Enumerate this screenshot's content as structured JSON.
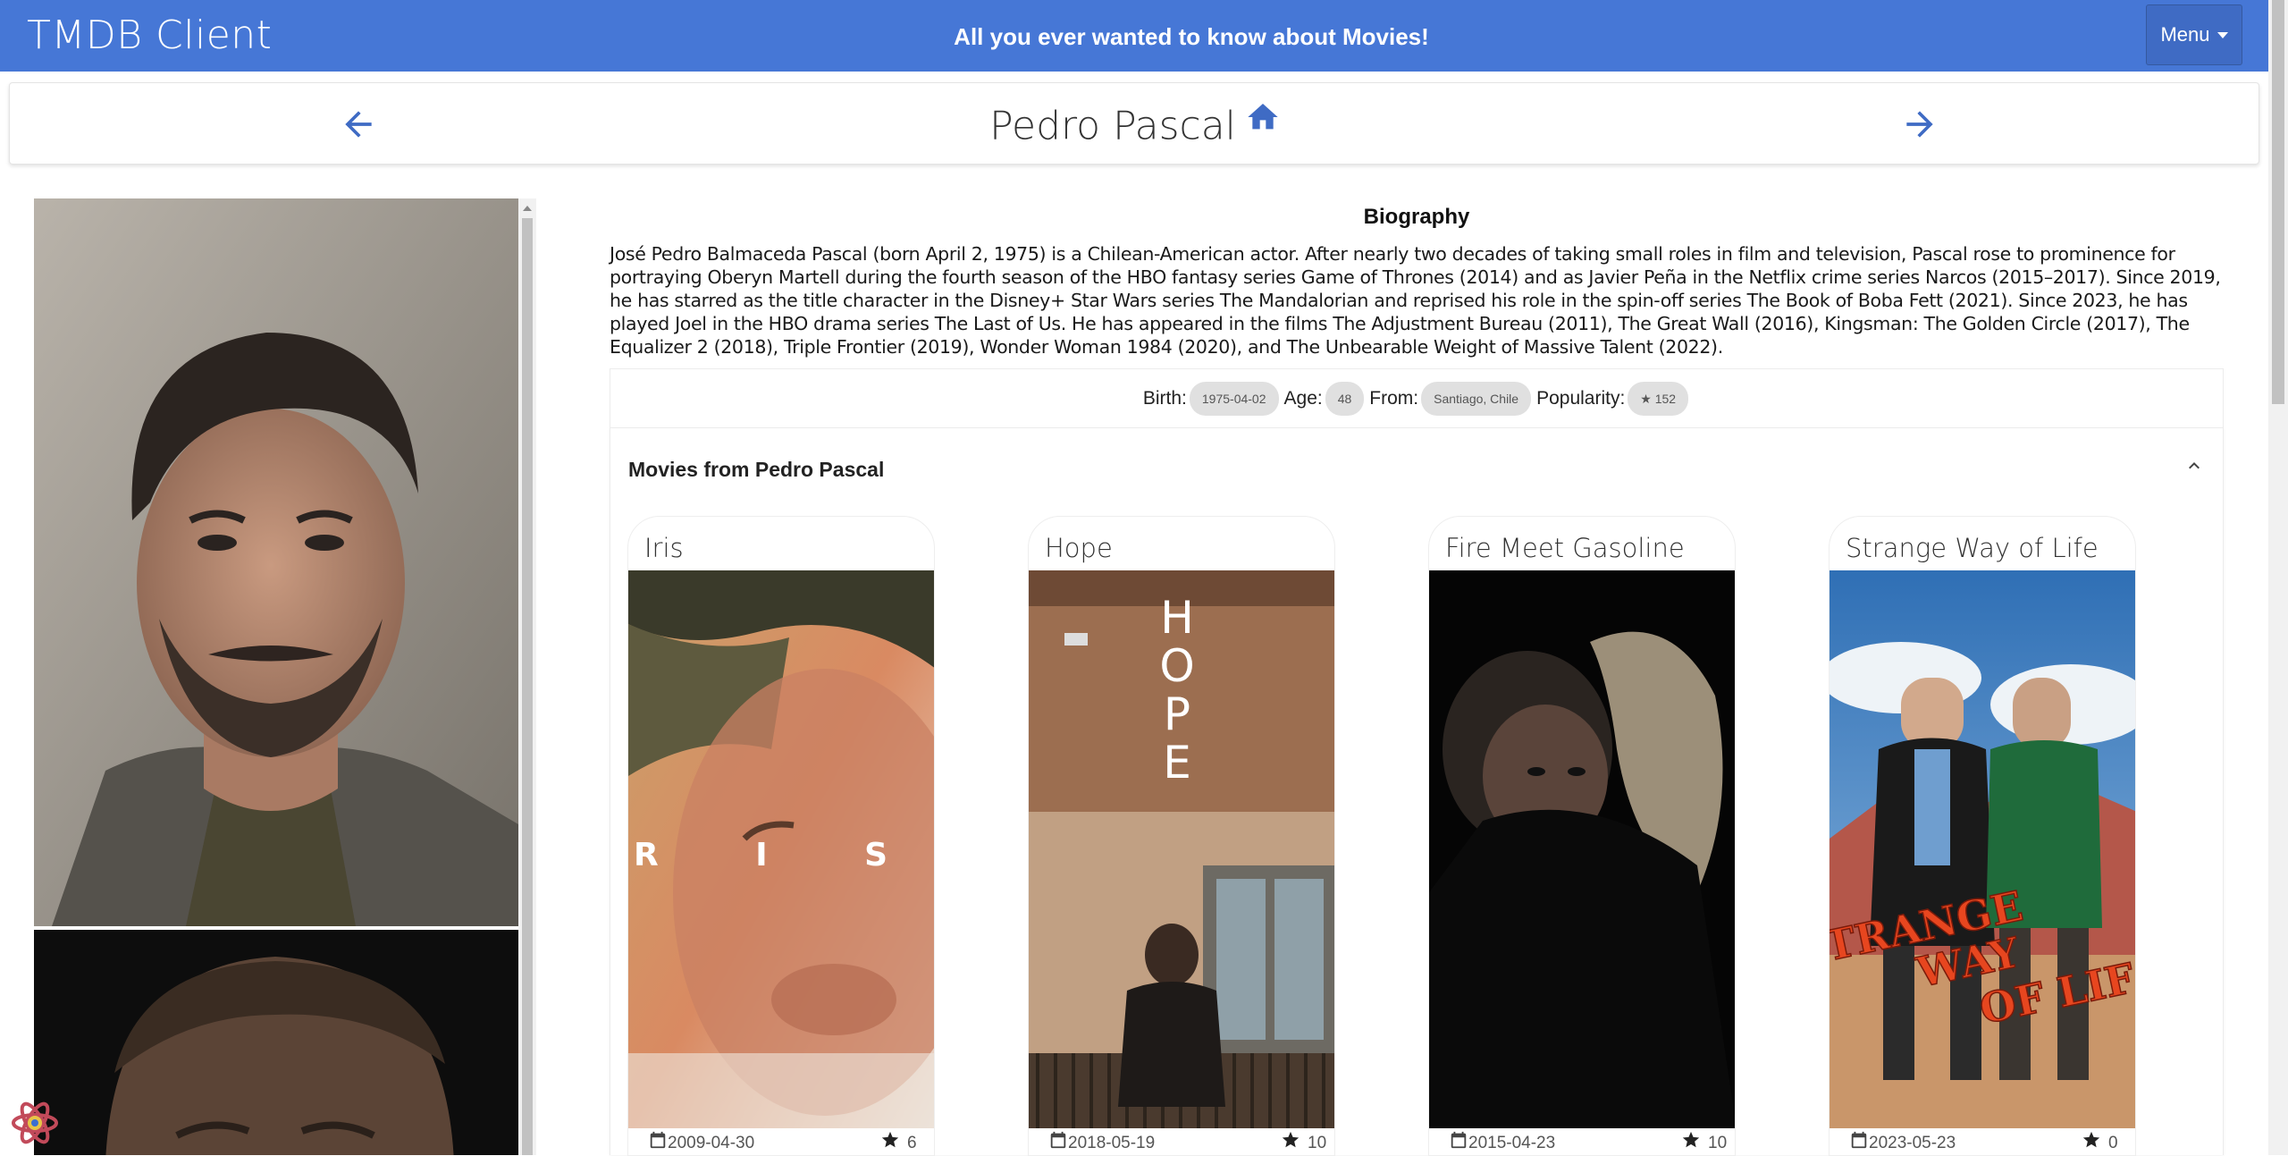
{
  "app": {
    "title": "TMDB Client",
    "tagline": "All you ever wanted to know about Movies!",
    "menu_label": "Menu"
  },
  "colors": {
    "app_bar": "#4677d6",
    "accent": "#3f6bc4",
    "chip": "#e0e0e0"
  },
  "person": {
    "name": "Pedro Pascal",
    "home_icon": "home-icon",
    "prev_icon": "arrow-left-icon",
    "next_icon": "arrow-right-icon"
  },
  "biography": {
    "heading": "Biography",
    "text": "José Pedro Balmaceda Pascal (born April 2, 1975) is a Chilean-American actor. After nearly two decades of taking small roles in film and television, Pascal rose to prominence for portraying Oberyn Martell during the fourth season of the HBO fantasy series Game of Thrones (2014) and as Javier Peña in the Netflix crime series Narcos (2015–2017). Since 2019, he has starred as the title character in the Disney+ Star Wars series The Mandalorian and reprised his role in the spin-off series The Book of Boba Fett (2021). Since 2023, he has played Joel in the HBO drama series The Last of Us. He has appeared in the films The Adjustment Bureau (2011), The Great Wall (2016), Kingsman: The Golden Circle (2017), The Equalizer 2 (2018), Triple Frontier (2019), Wonder Woman 1984 (2020), and The Unbearable Weight of Massive Talent (2022)."
  },
  "facts": {
    "birth_label": "Birth:",
    "birth_value": "1975-04-02",
    "age_label": "Age:",
    "age_value": "48",
    "from_label": "From:",
    "from_value": "Santiago, Chile",
    "popularity_label": "Popularity:",
    "popularity_value": "★ 152"
  },
  "movies": {
    "heading": "Movies from Pedro Pascal",
    "items": [
      {
        "title": "Iris",
        "date": "2009-04-30",
        "rating": "6",
        "poster_text": "R I S"
      },
      {
        "title": "Hope",
        "date": "2018-05-19",
        "rating": "10",
        "poster_text": "HOPE"
      },
      {
        "title": "Fire Meet Gasoline",
        "date": "2015-04-23",
        "rating": "10"
      },
      {
        "title": "Strange Way of Life",
        "date": "2023-05-23",
        "rating": "0",
        "poster_text": "TRANGE WAY OF LIF"
      }
    ]
  }
}
